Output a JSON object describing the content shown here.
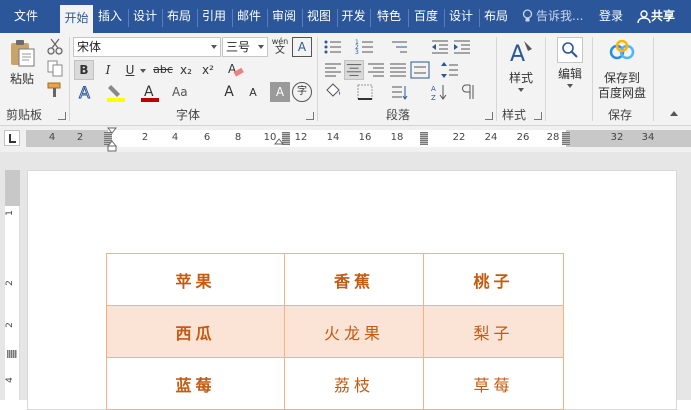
{
  "tabs": [
    {
      "label": "文件"
    },
    {
      "label": "开始",
      "active": true
    },
    {
      "label": "插入"
    },
    {
      "label": "设计"
    },
    {
      "label": "布局"
    },
    {
      "label": "引用"
    },
    {
      "label": "邮件"
    },
    {
      "label": "审阅"
    },
    {
      "label": "视图"
    },
    {
      "label": "开发"
    },
    {
      "label": "特色"
    },
    {
      "label": "百度"
    },
    {
      "label": "设计"
    },
    {
      "label": "布局"
    }
  ],
  "tell_me": "告诉我...",
  "login": "登录",
  "share": "共享",
  "ribbon": {
    "clipboard": {
      "paste": "粘贴",
      "group": "剪贴板"
    },
    "font": {
      "name": "宋体",
      "size": "三号",
      "bold": "B",
      "italic": "I",
      "underline": "U",
      "strike": "abc",
      "sub": "x₂",
      "sup": "x²",
      "grow": "A",
      "shrink": "A",
      "group": "字体",
      "wen": "wén",
      "char_border": "A",
      "char_shade": "A",
      "circle": "字"
    },
    "paragraph": {
      "group": "段落"
    },
    "styles": {
      "label": "样式",
      "group": "样式"
    },
    "editing": {
      "label": "编辑"
    },
    "save": {
      "label_line1": "保存到",
      "label_line2": "百度网盘",
      "group": "保存"
    },
    "colors": {
      "accent": "#2b579a",
      "highlight": "#ffff00",
      "font_color": "#c00000"
    }
  },
  "ruler": {
    "ticks": [
      "4",
      "2",
      "2",
      "4",
      "6",
      "8",
      "10",
      "12",
      "14",
      "16",
      "18",
      "22",
      "24",
      "26",
      "28",
      "32",
      "34"
    ]
  },
  "vruler": {
    "ticks": [
      "1",
      "2",
      "2",
      "4"
    ]
  },
  "table": {
    "rows": [
      {
        "cells": [
          "苹果",
          "香蕉",
          "桃子"
        ],
        "bold": [
          true,
          true,
          true
        ],
        "shaded": false
      },
      {
        "cells": [
          "西瓜",
          "火龙果",
          "梨子"
        ],
        "bold": [
          true,
          false,
          false
        ],
        "shaded": true
      },
      {
        "cells": [
          "蓝莓",
          "荔枝",
          "草莓"
        ],
        "bold": [
          true,
          false,
          false
        ],
        "shaded": false
      }
    ],
    "text_color": "#c55a11",
    "border_color": "#f4b183",
    "shade_color": "#fbe4d5"
  }
}
